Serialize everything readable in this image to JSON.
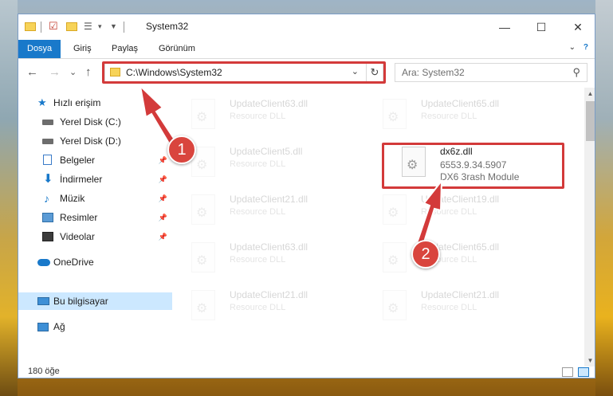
{
  "window": {
    "title": "System32",
    "controls": {
      "minimize": "—",
      "maximize": "☐",
      "close": "✕"
    }
  },
  "ribbon": {
    "tabs": [
      {
        "label": "Dosya",
        "active": true
      },
      {
        "label": "Giriş"
      },
      {
        "label": "Paylaş"
      },
      {
        "label": "Görünüm"
      }
    ],
    "expand": "⌄",
    "help": "?"
  },
  "navigation": {
    "back": "←",
    "forward": "→",
    "recent": "⌄",
    "up": "↑"
  },
  "address": {
    "path": "C:\\Windows\\System32",
    "dropdown": "⌄",
    "refresh": "↻"
  },
  "search": {
    "placeholder": "Ara: System32",
    "icon": "⚲"
  },
  "sidebar": {
    "items": [
      {
        "label": "Hızlı erişim",
        "icon": "star-icon",
        "pinned": false
      },
      {
        "label": "Yerel Disk (C:)",
        "icon": "drive-icon",
        "pinned": false
      },
      {
        "label": "Yerel Disk (D:)",
        "icon": "drive-icon",
        "pinned": false
      },
      {
        "label": "Belgeler",
        "icon": "documents-icon",
        "pinned": true
      },
      {
        "label": "İndirmeler",
        "icon": "download-icon",
        "pinned": true
      },
      {
        "label": "Müzik",
        "icon": "music-icon",
        "pinned": true
      },
      {
        "label": "Resimler",
        "icon": "pictures-icon",
        "pinned": true
      },
      {
        "label": "Videolar",
        "icon": "video-icon",
        "pinned": true
      },
      {
        "label": "OneDrive",
        "icon": "cloud-icon",
        "pinned": false
      },
      {
        "label": "Bu bilgisayar",
        "icon": "computer-icon",
        "pinned": false,
        "selected": true
      },
      {
        "label": "Ağ",
        "icon": "network-icon",
        "pinned": false
      }
    ]
  },
  "files": [
    {
      "name": "UpdateClient63.dll",
      "type": "Resource DLL"
    },
    {
      "name": "UpdateClient65.dll",
      "type": "Resource DLL"
    },
    {
      "name": "UpdateClient5.dll",
      "type": "Resource DLL"
    },
    {
      "name": "dx6z.dll",
      "version": "6553.9.34.5907",
      "type": "DX6 3rash Module",
      "highlighted": true
    },
    {
      "name": "UpdateClient21.dll",
      "type": "Resource DLL"
    },
    {
      "name": "UpdateClient19.dll",
      "type": "Resource DLL"
    },
    {
      "name": "UpdateClient63.dll",
      "type": "Resource DLL"
    },
    {
      "name": "UpdateClient65.dll",
      "type": "Resource DLL"
    },
    {
      "name": "UpdateClient21.dll",
      "type": "Resource DLL"
    },
    {
      "name": "UpdateClient21.dll",
      "type": "Resource DLL"
    }
  ],
  "status": {
    "count": "180 öğe"
  },
  "annotations": {
    "badge1": "1",
    "badge2": "2",
    "color": "#d33a3a"
  }
}
